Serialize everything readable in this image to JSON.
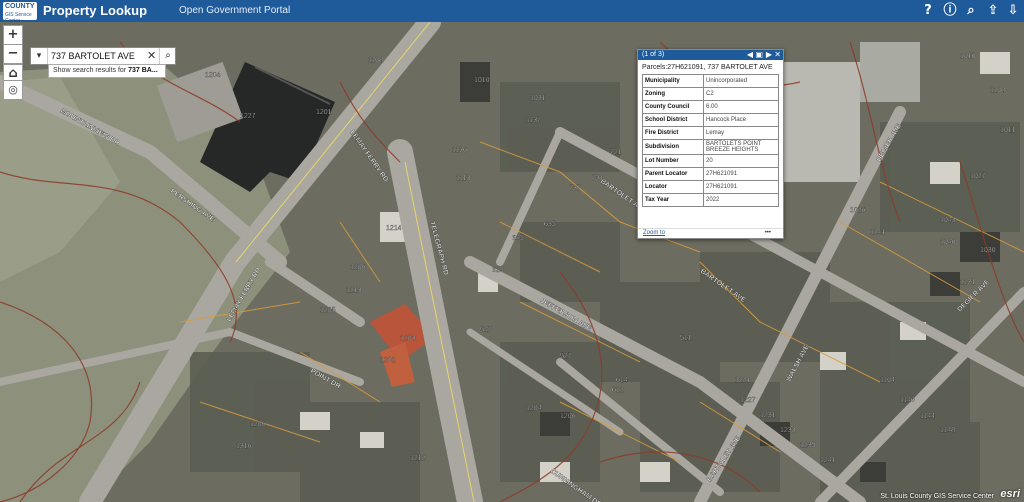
{
  "header": {
    "logo_line1": "COUNTY",
    "logo_line2": "GIS Service Center",
    "app_title": "Property Lookup",
    "portal_link": "Open Government Portal"
  },
  "toolbar_icons": [
    "help-icon",
    "info-icon",
    "search-icon",
    "share-icon",
    "download-icon"
  ],
  "map_controls": {
    "zoom_in": "+",
    "zoom_out": "−"
  },
  "search": {
    "value": "737 BARTOLET AVE",
    "suggestion_prefix": "Show search results for ",
    "suggestion_term": "737 BA..."
  },
  "popup": {
    "counter": "(1 of 3)",
    "parcel_title": "Parcels:27H621091, 737 BARTOLET AVE",
    "rows": [
      {
        "key": "Municipality",
        "value": "Unincorporated"
      },
      {
        "key": "Zoning",
        "value": "C2"
      },
      {
        "key": "County Council",
        "value": "6.00"
      },
      {
        "key": "School District",
        "value": "Hancock Place"
      },
      {
        "key": "Fire District",
        "value": "Lemay"
      },
      {
        "key": "Subdivision",
        "value": "BARTOLETS POINT BREEZE HEIGHTS"
      },
      {
        "key": "Lot Number",
        "value": "20"
      },
      {
        "key": "Parent Locator",
        "value": "27H621091"
      },
      {
        "key": "Locator",
        "value": "27H621091"
      },
      {
        "key": "Tax Year",
        "value": "2022"
      }
    ],
    "zoom_to": "Zoom to",
    "more": "•••"
  },
  "streets": [
    "MOUNTAINVIEW DR",
    "LEMAY FERRY RD",
    "LEMAY FERRY RD",
    "PERSHING AVE",
    "TELEGRAPH RD",
    "BARTOLET AVE",
    "BARTOLET AVE",
    "JEFFERSON AVE",
    "POINT DR",
    "WALSH AVE",
    "DEGIER AVE",
    "DEGIER AVE",
    "BARTOLET AVE",
    "CUNNINGHAM DR"
  ],
  "parcel_numbers": [
    "1227",
    "1201",
    "1204",
    "1108",
    "1010",
    "1031",
    "1137",
    "1136",
    "1113",
    "1206",
    "1214",
    "1213",
    "1205",
    "1203",
    "1202",
    "721",
    "731",
    "737",
    "645",
    "635",
    "629",
    "547",
    "614",
    "612",
    "511",
    "527",
    "1043",
    "1027",
    "1011",
    "1040",
    "1010",
    "1026",
    "1141",
    "1030",
    "1131",
    "1108",
    "1221",
    "1227",
    "1231",
    "1233",
    "1239",
    "1241",
    "1104",
    "1140",
    "1144",
    "1148",
    "1204",
    "1206",
    "1212",
    "1206",
    "1316"
  ],
  "attribution": "St. Louis County GIS Service Center",
  "esri_logo": "esri"
}
